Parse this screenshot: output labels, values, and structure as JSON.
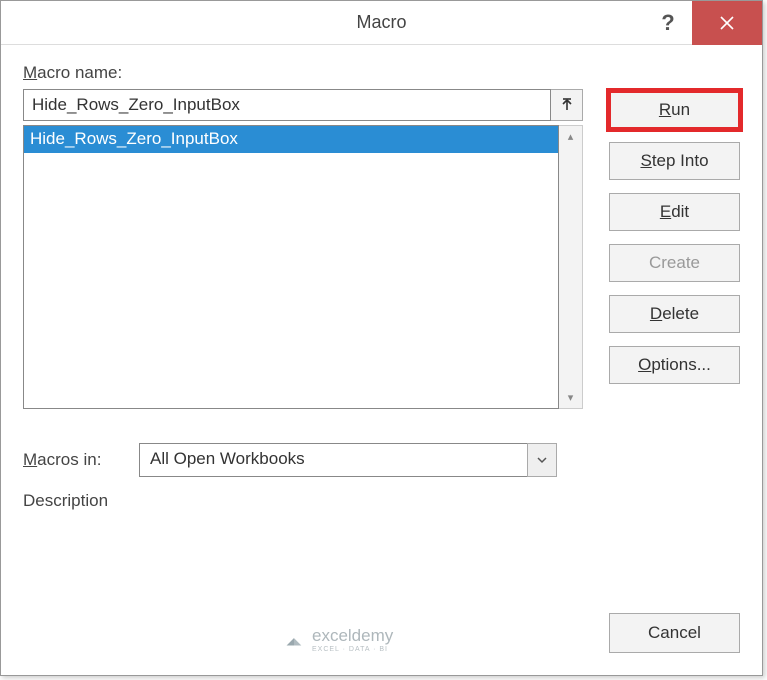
{
  "title": "Macro",
  "labels": {
    "macroName": "acro name:",
    "macroNameAccel": "M",
    "macrosIn": "acros in:",
    "macrosInAccel": "M",
    "description": "Description"
  },
  "macroNameInput": "Hide_Rows_Zero_InputBox",
  "macroList": [
    {
      "name": "Hide_Rows_Zero_InputBox",
      "selected": true
    }
  ],
  "macrosInSelected": "All Open Workbooks",
  "buttons": {
    "run": {
      "accel": "R",
      "rest": "un"
    },
    "stepInto": {
      "accel": "S",
      "rest": "tep Into"
    },
    "edit": {
      "accel": "E",
      "rest": "dit"
    },
    "create": {
      "label": "Create",
      "disabled": true
    },
    "delete": {
      "accel": "D",
      "rest": "elete"
    },
    "options": {
      "accel": "O",
      "rest": "ptions..."
    },
    "cancel": {
      "label": "Cancel"
    }
  },
  "watermark": {
    "brand": "exceldemy",
    "sub": "EXCEL · DATA · BI"
  }
}
